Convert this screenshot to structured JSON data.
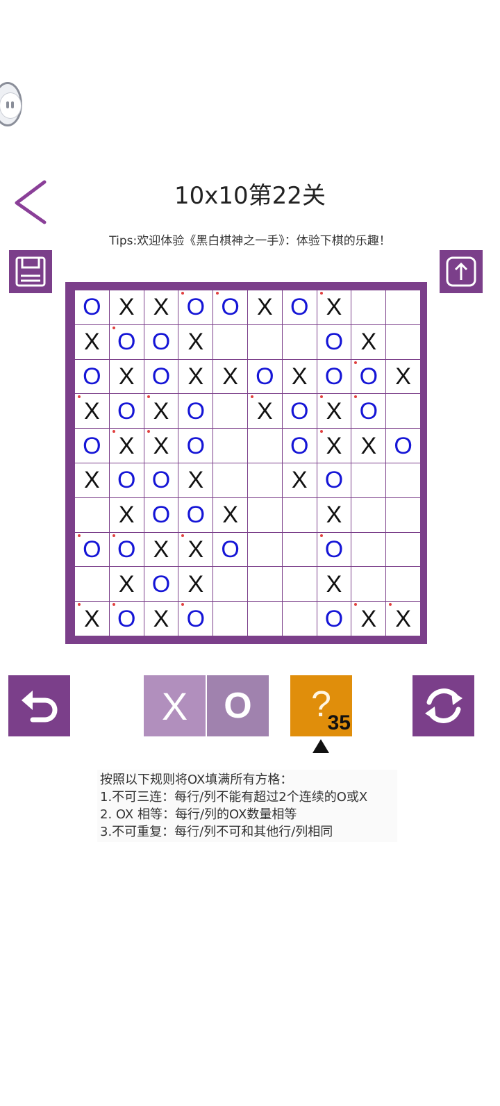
{
  "header": {
    "title": "10x10第22关",
    "tips": "Tips:欢迎体验《黑白棋神之一手》：体验下棋的乐趣！"
  },
  "colors": {
    "accent": "#7b3f8a",
    "o_color": "#1515d6",
    "x_color": "#111111",
    "hint": "#e08e0b"
  },
  "board": {
    "size": "10x10",
    "rows": [
      [
        "O",
        "X",
        "X",
        "O",
        "O",
        "X",
        "O",
        "X",
        "",
        ""
      ],
      [
        "X",
        "O",
        "O",
        "X",
        "",
        "",
        "",
        "O",
        "X",
        ""
      ],
      [
        "O",
        "X",
        "O",
        "X",
        "X",
        "O",
        "X",
        "O",
        "O",
        "X"
      ],
      [
        "X",
        "O",
        "X",
        "O",
        "",
        "X",
        "O",
        "X",
        "O",
        ""
      ],
      [
        "O",
        "X",
        "X",
        "O",
        "",
        "",
        "O",
        "X",
        "X",
        "O"
      ],
      [
        "X",
        "O",
        "O",
        "X",
        "",
        "",
        "X",
        "O",
        "",
        ""
      ],
      [
        "",
        "X",
        "O",
        "O",
        "X",
        "",
        "",
        "X",
        "",
        ""
      ],
      [
        "O",
        "O",
        "X",
        "X",
        "O",
        "",
        "",
        "O",
        "",
        ""
      ],
      [
        "",
        "X",
        "O",
        "X",
        "",
        "",
        "",
        "X",
        "",
        ""
      ],
      [
        "X",
        "O",
        "X",
        "O",
        "",
        "",
        "",
        "O",
        "X",
        "X"
      ]
    ],
    "marked": [
      [
        0,
        3
      ],
      [
        0,
        4
      ],
      [
        0,
        7
      ],
      [
        1,
        1
      ],
      [
        2,
        8
      ],
      [
        3,
        0
      ],
      [
        3,
        2
      ],
      [
        3,
        5
      ],
      [
        3,
        7
      ],
      [
        3,
        8
      ],
      [
        4,
        1
      ],
      [
        4,
        2
      ],
      [
        4,
        7
      ],
      [
        7,
        0
      ],
      [
        7,
        1
      ],
      [
        7,
        3
      ],
      [
        7,
        7
      ],
      [
        9,
        0
      ],
      [
        9,
        1
      ],
      [
        9,
        3
      ],
      [
        9,
        8
      ],
      [
        9,
        9
      ]
    ]
  },
  "controls": {
    "pick_x_label": "X",
    "pick_o_label": "O",
    "hint_label": "?",
    "hint_count": "35",
    "undo_icon": "undo-icon",
    "refresh_icon": "refresh-icon",
    "save_icon": "save-icon",
    "share_icon": "share-icon"
  },
  "rules": {
    "heading": "按照以下规则将OX填满所有方格：",
    "items": [
      "1.不可三连：每行/列不能有超过2个连续的O或X",
      "2. OX 相等：每行/列的OX数量相等",
      "3.不可重复：每行/列不可和其他行/列相同"
    ]
  }
}
